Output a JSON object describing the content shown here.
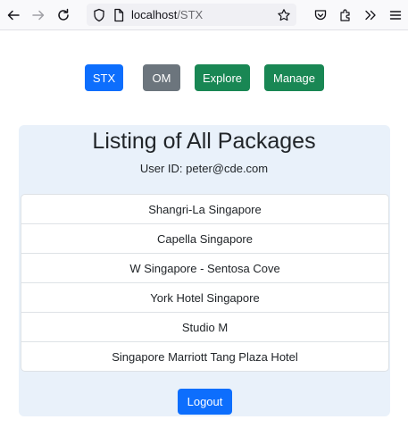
{
  "browser": {
    "url_host": "localhost",
    "url_path": "/STX"
  },
  "nav": {
    "buttons": [
      {
        "label": "STX",
        "color": "#0d6efd"
      },
      {
        "label": "OM",
        "color": "#6c757d"
      },
      {
        "label": "Explore",
        "color": "#198754"
      },
      {
        "label": "Manage",
        "color": "#198754"
      }
    ]
  },
  "card": {
    "title": "Listing of All Packages",
    "user_line": "User ID: peter@cde.com",
    "background": "#e9f1fa"
  },
  "packages": [
    "Shangri-La Singapore",
    "Capella Singapore",
    "W Singapore - Sentosa Cove",
    "York Hotel Singapore",
    "Studio M",
    "Singapore Marriott Tang Plaza Hotel"
  ],
  "logout_label": "Logout"
}
